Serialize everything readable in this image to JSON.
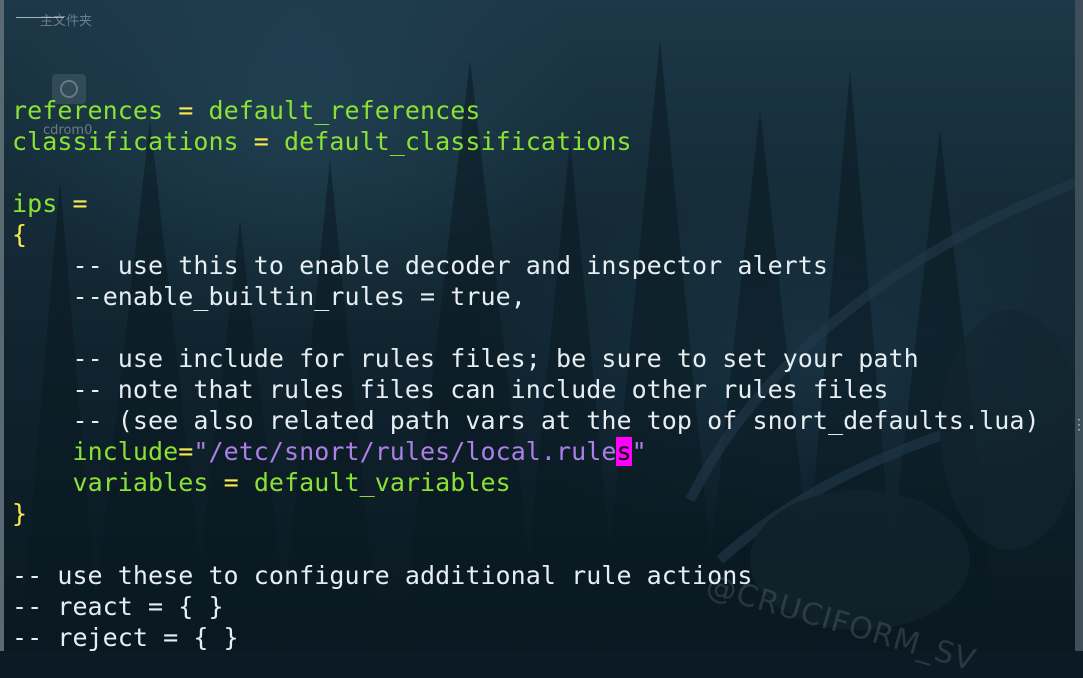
{
  "desktop": {
    "folder_label": "主文件夹",
    "cdrom_label": "cdrom0",
    "watermark": "@CRUCIFORM_SV"
  },
  "editor": {
    "lines": [
      {
        "kind": "blank"
      },
      {
        "kind": "assign",
        "name": "references",
        "op": " = ",
        "value": "default_references"
      },
      {
        "kind": "assign",
        "name": "classifications",
        "op": " = ",
        "value": "default_classifications"
      },
      {
        "kind": "blank"
      },
      {
        "kind": "assign",
        "name": "ips",
        "op": " =",
        "value": ""
      },
      {
        "kind": "brace",
        "text": "{"
      },
      {
        "kind": "comment",
        "indent": "    ",
        "text": "-- use this to enable decoder and inspector alerts"
      },
      {
        "kind": "commented_assign",
        "indent": "    ",
        "prefix": "--",
        "name": "enable_builtin_rules",
        "op": " = ",
        "value": "true,",
        "value_color": "plain"
      },
      {
        "kind": "blank"
      },
      {
        "kind": "comment",
        "indent": "    ",
        "text": "-- use include for rules files; be sure to set your path"
      },
      {
        "kind": "comment",
        "indent": "    ",
        "text": "-- note that rules files can include other rules files"
      },
      {
        "kind": "comment",
        "indent": "    ",
        "text": "-- (see also related path vars at the top of snort_defaults.lua)"
      },
      {
        "kind": "include",
        "indent": "    ",
        "name": "include",
        "op": "=",
        "string_before_cursor": "\"/etc/snort/rules/local.rule",
        "cursor_char": "s",
        "string_after_cursor": "\""
      },
      {
        "kind": "assign_indent",
        "indent": "    ",
        "name": "variables",
        "op": " = ",
        "value": "default_variables"
      },
      {
        "kind": "brace",
        "text": "}"
      },
      {
        "kind": "blank"
      },
      {
        "kind": "comment",
        "indent": "",
        "text": "-- use these to configure additional rule actions"
      },
      {
        "kind": "comment",
        "indent": "",
        "text": "-- react = { }"
      },
      {
        "kind": "comment",
        "indent": "",
        "text": "-- reject = { }"
      }
    ]
  },
  "colors": {
    "identifier": "#8ae234",
    "operator": "#fce94f",
    "comment": "#e6eef2",
    "string": "#ad7fe8",
    "cursor_bg": "#ff00ff"
  }
}
